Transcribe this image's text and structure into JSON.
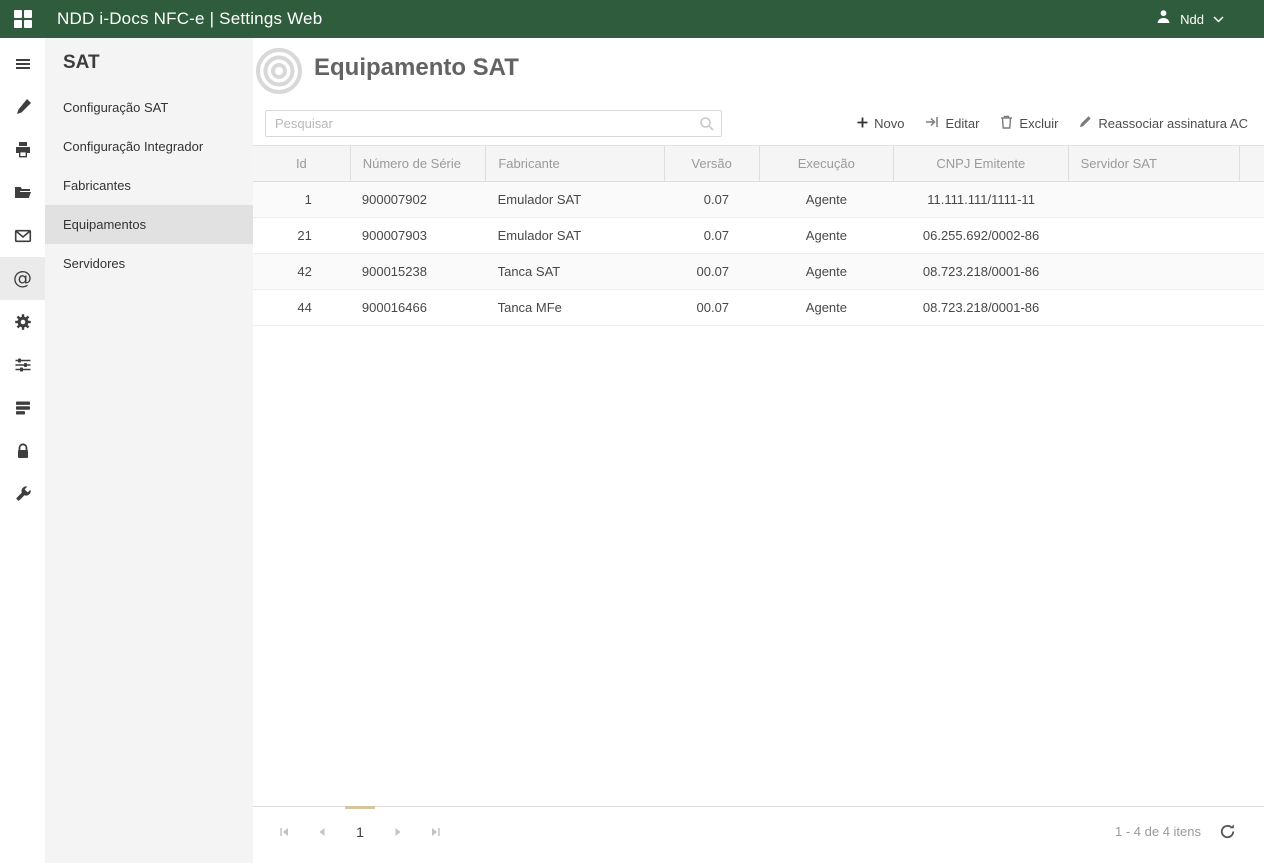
{
  "topbar": {
    "title": "NDD i-Docs NFC-e | Settings Web",
    "user_name": "Ndd"
  },
  "rail": {
    "icons": [
      "menu",
      "tools",
      "printer",
      "folder",
      "mail",
      "at",
      "gear",
      "sliders",
      "layers",
      "lock",
      "wrench"
    ],
    "active_icon": "at"
  },
  "sidebar": {
    "title": "SAT",
    "items": [
      {
        "label": "Configuração SAT"
      },
      {
        "label": "Configuração Integrador"
      },
      {
        "label": "Fabricantes"
      },
      {
        "label": "Equipamentos",
        "active": true
      },
      {
        "label": "Servidores"
      }
    ]
  },
  "main": {
    "title": "Equipamento SAT",
    "search_placeholder": "Pesquisar",
    "actions": [
      {
        "label": "Novo",
        "icon": "plus"
      },
      {
        "label": "Editar",
        "icon": "edit"
      },
      {
        "label": "Excluir",
        "icon": "trash"
      },
      {
        "label": "Reassociar assinatura AC",
        "icon": "pencil"
      }
    ],
    "table": {
      "columns": [
        "Id",
        "Número de Série",
        "Fabricante",
        "Versão",
        "Execução",
        "CNPJ Emitente",
        "Servidor SAT"
      ],
      "rows": [
        [
          "1",
          "900007902",
          "Emulador SAT",
          "0.07",
          "Agente",
          "11.111.111/1111-11",
          ""
        ],
        [
          "21",
          "900007903",
          "Emulador SAT",
          "0.07",
          "Agente",
          "06.255.692/0002-86",
          ""
        ],
        [
          "42",
          "900015238",
          "Tanca SAT",
          "00.07",
          "Agente",
          "08.723.218/0001-86",
          ""
        ],
        [
          "44",
          "900016466",
          "Tanca MFe",
          "00.07",
          "Agente",
          "08.723.218/0001-86",
          ""
        ]
      ]
    },
    "pager": {
      "page": "1",
      "status": "1 - 4 de 4 itens"
    }
  },
  "colors": {
    "topbar_green": "#2e5c3c",
    "selected_page_indicator": "#d8c49c",
    "sidebar_bg": "#f4f4f4",
    "selected_item_bg": "#e1e1e1",
    "header_row_bg": "#f5f5f5"
  }
}
